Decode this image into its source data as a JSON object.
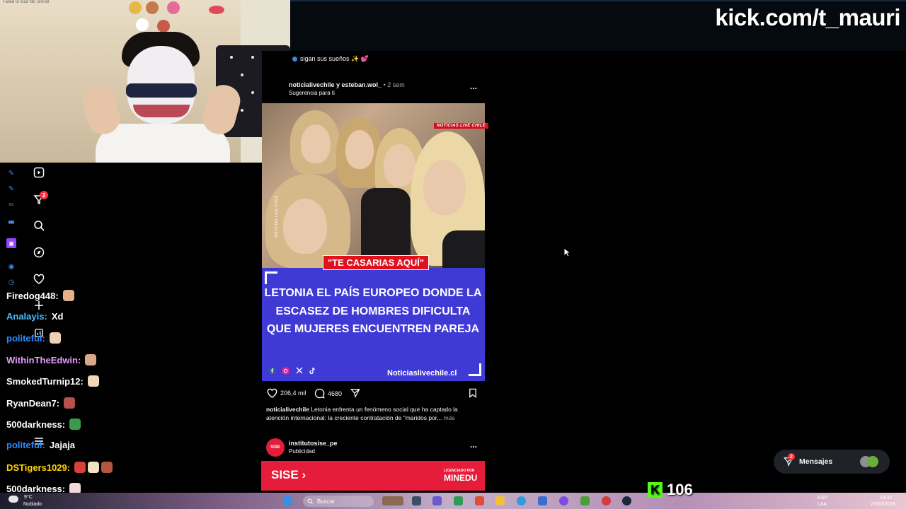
{
  "webcam": {
    "error_text": "Failed to load file: preroll"
  },
  "stream": {
    "url": "kick.com/t_mauri",
    "viewer_count": "106",
    "kick_logo": "K"
  },
  "notification_line": {
    "text": "sigan sus sueños ✨ 💕"
  },
  "nav": {
    "notification_badge": "2"
  },
  "chat": [
    {
      "user": "Firedog448:",
      "color": "#ffffff",
      "message": "",
      "emotes": 1
    },
    {
      "user": "Analayis:",
      "color": "#46c0ff",
      "message": "Xd",
      "emotes": 0
    },
    {
      "user": "politeful:",
      "color": "#2b8cff",
      "message": "",
      "emotes": 1
    },
    {
      "user": "WithinTheEdwin:",
      "color": "#e49cff",
      "message": "",
      "emotes": 1
    },
    {
      "user": "SmokedTurnip12:",
      "color": "#ffffff",
      "message": "",
      "emotes": 1
    },
    {
      "user": "RyanDean7:",
      "color": "#ffffff",
      "message": "",
      "emotes": 1
    },
    {
      "user": "500darkness:",
      "color": "#ffffff",
      "message": "",
      "emotes": 1
    },
    {
      "user": "politeful:",
      "color": "#2b8cff",
      "message": "Jajaja",
      "emotes": 0
    },
    {
      "user": "DSTigers1029:",
      "color": "#ffd400",
      "message": "",
      "emotes": 3
    },
    {
      "user": "500darkness:",
      "color": "#ffffff",
      "message": "",
      "emotes": 1
    }
  ],
  "post": {
    "author": "noticialivechile y esteban.wol_",
    "age": "• 2 sem",
    "suggestion": "Sugerencia para ti",
    "more": "...",
    "image_tag": "NOTICIAS LIVE CHILE",
    "side_text": "NOTICIAS LIVE CHILE",
    "tagline": "\"TE CASARIAS AQUÍ\"",
    "headline": "Letonia el país europeo donde la escasez de hombres dificulta que mujeres encuentren pareja",
    "site": "Noticiaslivechile.cl",
    "likes": "206,4 mil",
    "comments": "4680",
    "caption_user": "noticialivechile",
    "caption_text": "Letonia enfrenta un fenómeno social que ha captado la atención internacional: la creciente contratación de \"maridos por...",
    "caption_more": "más"
  },
  "ad": {
    "account": "institutosise_pe",
    "label": "Publicidad",
    "logo_text": "SISE",
    "brand": "SISE ›",
    "licensed": "LICENCIADO POR",
    "minedu": "MINEDU",
    "more": "..."
  },
  "messages": {
    "label": "Mensajes",
    "badge": "2"
  },
  "taskbar": {
    "weather_temp": "9°C",
    "weather_desc": "Nublado",
    "search": "Buscar",
    "lang": "ESP",
    "lang2": "LAA",
    "time": "19:42",
    "date": "23/03/2026"
  },
  "colors": {
    "ig_bg": "#000000",
    "kick_green": "#53fc18",
    "badge_red": "#ff3040",
    "headline_blue": "#3f3ad6",
    "tag_red": "#e0101c"
  }
}
